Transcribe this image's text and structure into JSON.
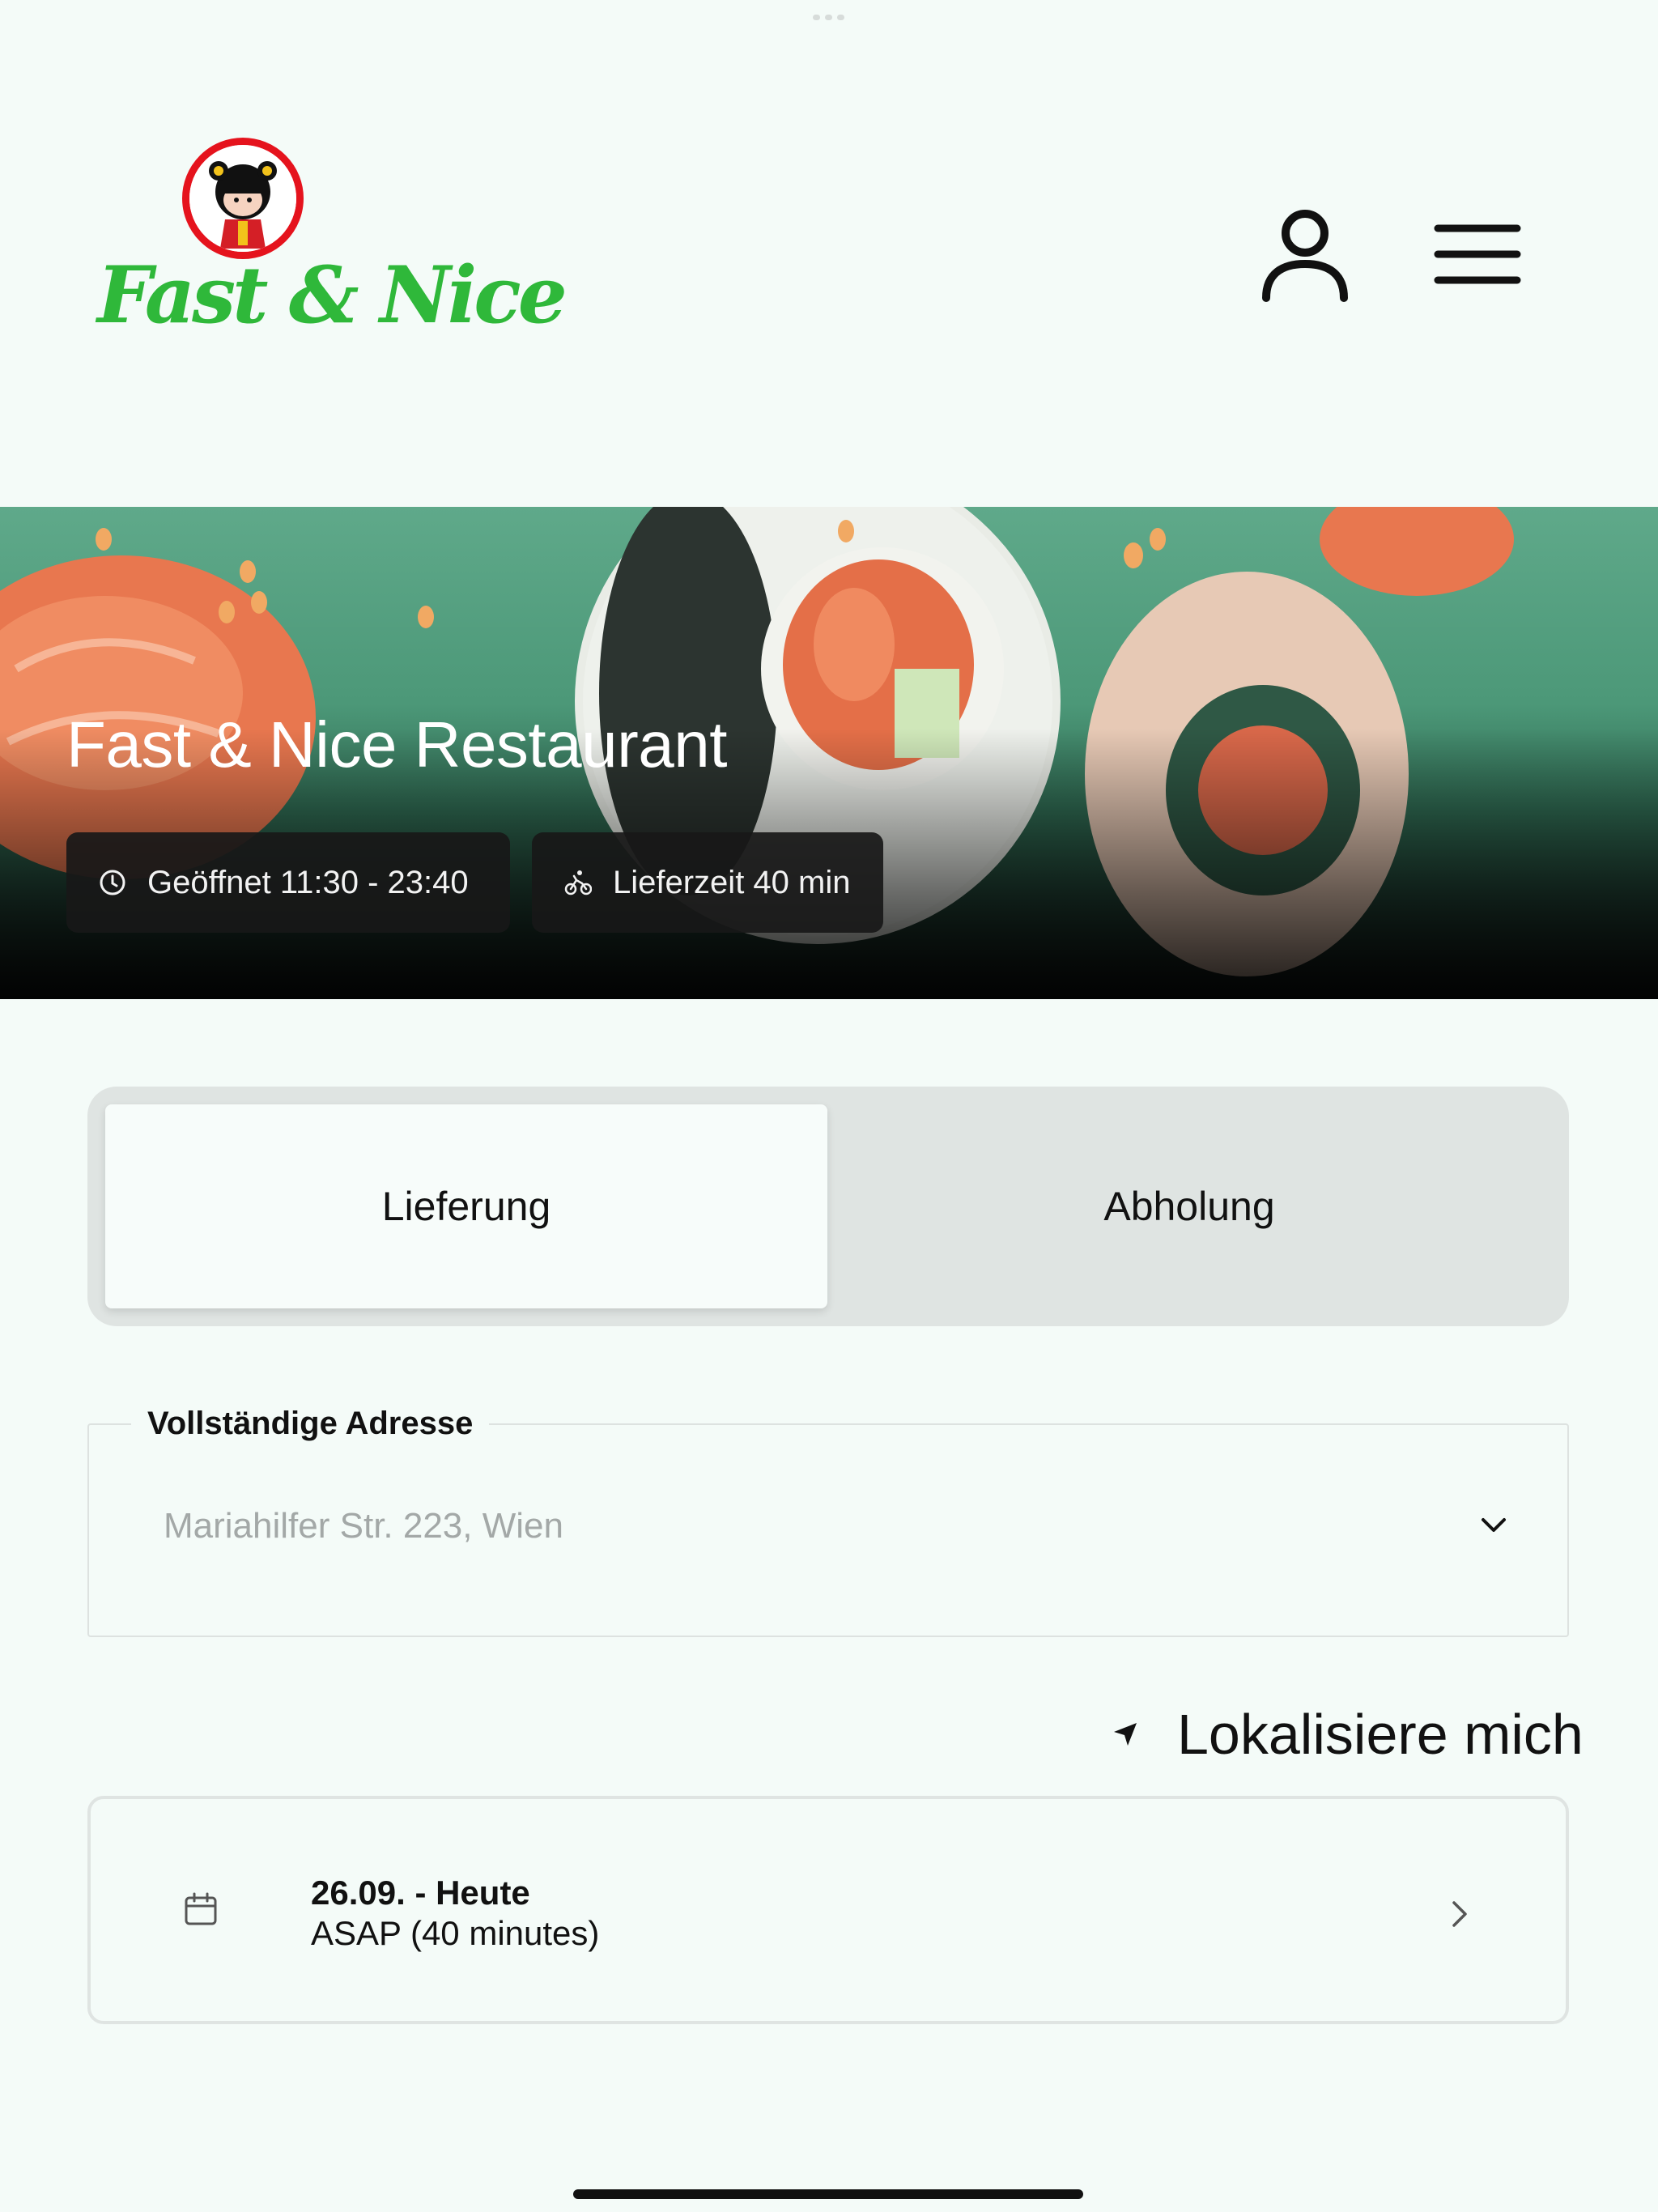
{
  "header": {
    "logo_text": "Fast & Nice",
    "user_icon": "user-icon",
    "menu_icon": "menu-icon"
  },
  "hero": {
    "title": "Fast & Nice Restaurant",
    "open_label": "Geöffnet 11:30 - 23:40",
    "open_icon": "clock-icon",
    "delivery_label": "Lieferzeit 40 min",
    "delivery_icon": "bike-icon"
  },
  "order_type": {
    "options": [
      "Lieferung",
      "Abholung"
    ],
    "selected": "Lieferung"
  },
  "address": {
    "label": "Vollständige Adresse",
    "placeholder": "Mariahilfer Str. 223, Wien",
    "dropdown_icon": "chevron-down-icon"
  },
  "locate": {
    "label": "Lokalisiere mich",
    "icon": "location-arrow-icon"
  },
  "schedule": {
    "date_label": "26.09. - Heute",
    "time_label": "ASAP (40 minutes)",
    "icon": "calendar-icon",
    "arrow_icon": "chevron-right-icon"
  },
  "colors": {
    "background": "#f4fbf8",
    "brand_green": "#2fb83a",
    "brand_red": "#e5131d",
    "chip_bg": "#181818",
    "segment_bg": "#dfe4e2"
  }
}
